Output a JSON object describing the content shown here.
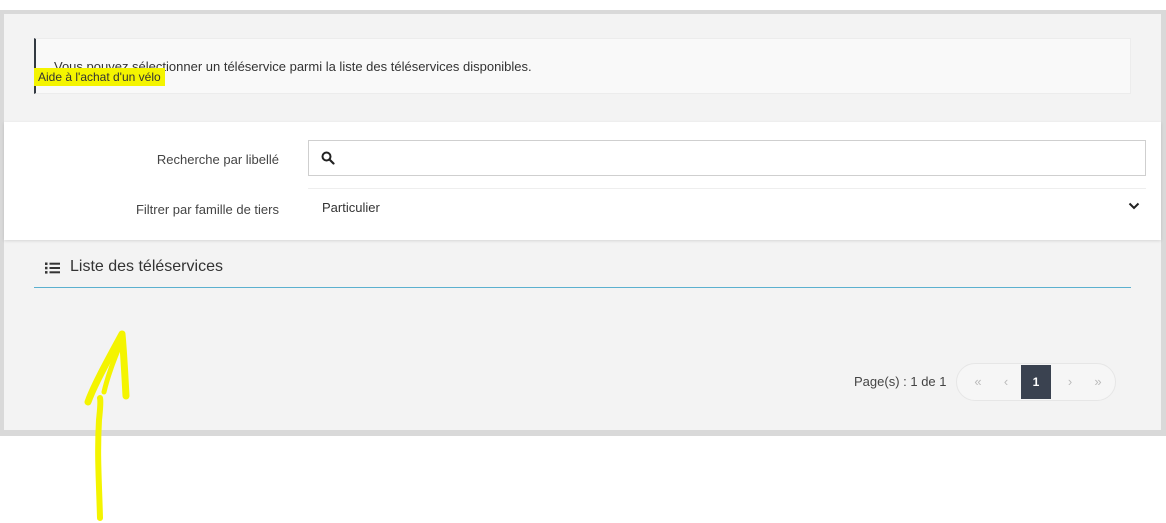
{
  "info": {
    "message": "Vous pouvez sélectionner un téléservice parmi la liste des téléservices disponibles."
  },
  "filters": {
    "search_label": "Recherche par libellé",
    "search_value": "",
    "family_label": "Filtrer par famille de tiers",
    "family_selected": "Particulier"
  },
  "list": {
    "title": "Liste des téléservices",
    "items": [
      {
        "label": "Aide à l'achat d'un vélo"
      }
    ]
  },
  "pagination": {
    "label": "Page(s) : 1 de 1",
    "first": "«",
    "prev": "‹",
    "current": "1",
    "next": "›",
    "last": "»"
  },
  "colors": {
    "highlight": "#f4f400",
    "accent_line": "#5bb0cf",
    "active_page": "#3a4250"
  },
  "annotation": {
    "type": "hand-drawn-arrow-icon",
    "color": "#f4f400"
  }
}
